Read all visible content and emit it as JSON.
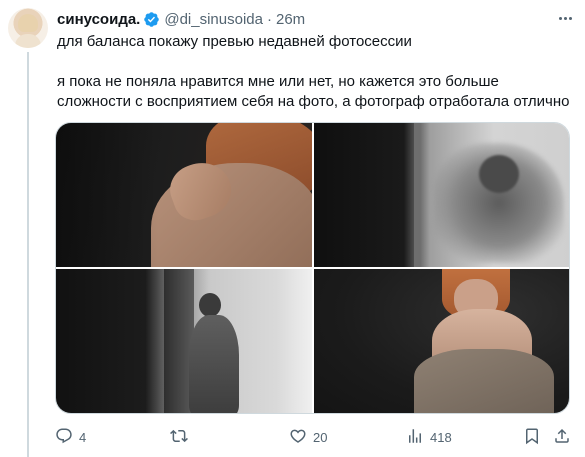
{
  "tweet": {
    "display_name": "синусоида.",
    "handle": "@di_sinusoida",
    "separator": "·",
    "time": "26m",
    "text_line1": "для баланса покажу превью недавней фотосессии",
    "text_line2": "я пока не поняла нравится мне или нет, но кажется это больше",
    "text_line3": "сложности с восприятием себя на фото, а фотограф отработала отлично"
  },
  "icons": {
    "verified": "verified-badge-icon",
    "more": "more-options-icon",
    "reply": "reply-icon",
    "retweet": "retweet-icon",
    "like": "like-icon",
    "views": "views-icon",
    "bookmark": "bookmark-icon",
    "share": "share-icon"
  },
  "actions": {
    "reply_count": "4",
    "retweet_count": "",
    "like_count": "20",
    "view_count": "418"
  },
  "colors": {
    "accent": "#1d9bf0",
    "text_primary": "#0f1419",
    "text_secondary": "#536471",
    "border": "#cfd9de"
  }
}
